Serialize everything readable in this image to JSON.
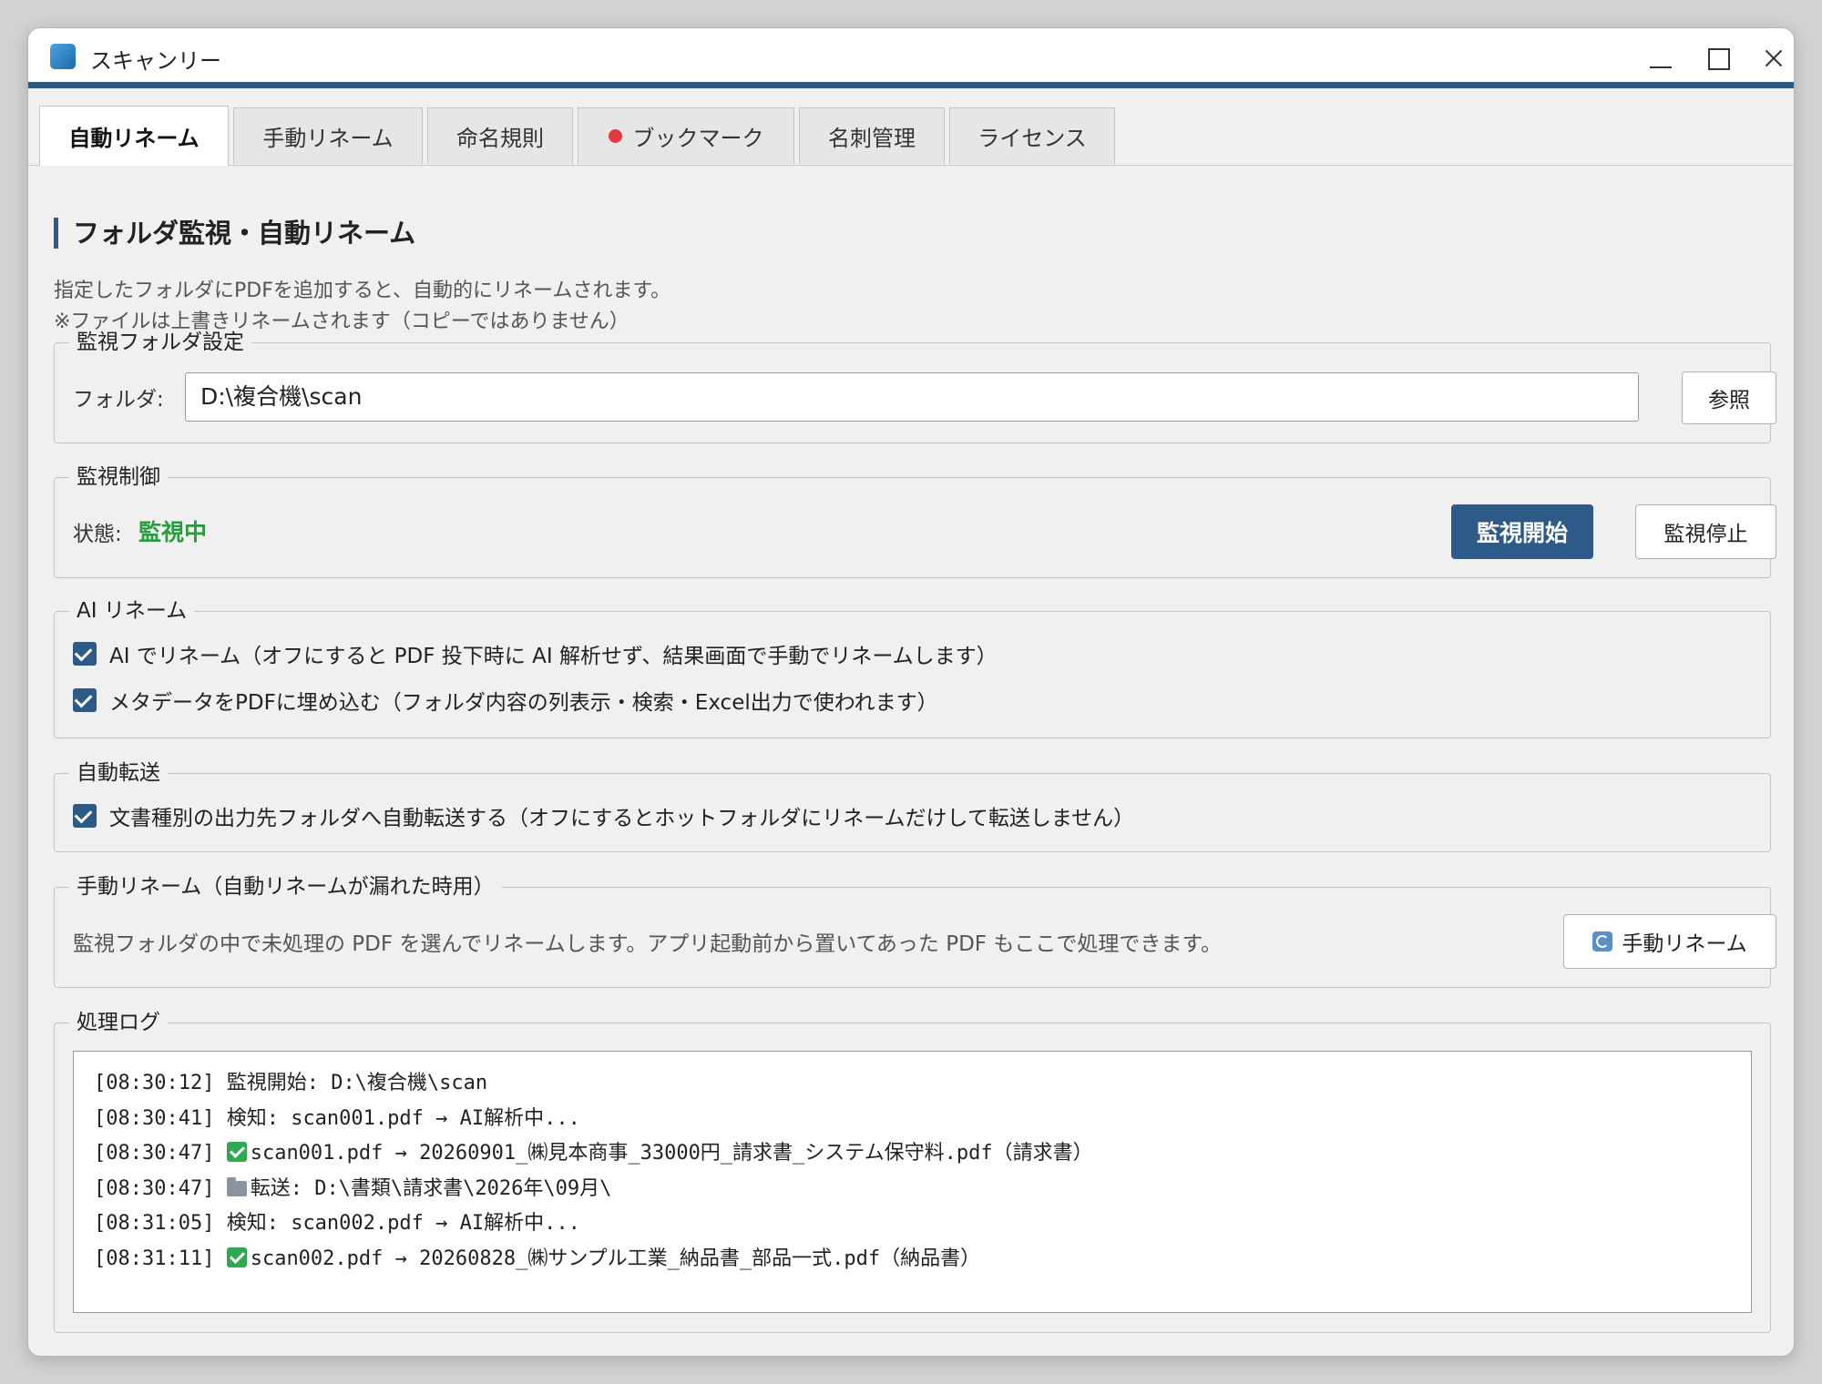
{
  "window": {
    "title": "スキャンリー"
  },
  "tabs": [
    {
      "label": "自動リネーム",
      "active": true
    },
    {
      "label": "手動リネーム"
    },
    {
      "label": "命名規則"
    },
    {
      "label": "ブックマーク",
      "indicator_color": "#e03b3b"
    },
    {
      "label": "名刺管理"
    },
    {
      "label": "ライセンス"
    }
  ],
  "section": {
    "title": "フォルダ監視・自動リネーム",
    "desc1": "指定したフォルダにPDFを追加すると、自動的にリネームされます。",
    "desc2": "※ファイルは上書きリネームされます（コピーではありません）"
  },
  "folder_settings": {
    "legend": "監視フォルダ設定",
    "folder_label": "フォルダ:",
    "folder_value": "D:\\複合機\\scan",
    "browse_label": "参照"
  },
  "monitor_control": {
    "legend": "監視制御",
    "status_label": "状態:",
    "status_value": "監視中",
    "start_label": "監視開始",
    "stop_label": "監視停止"
  },
  "ai_rename": {
    "legend": "AI リネーム",
    "options": [
      {
        "label": "AI でリネーム（オフにすると PDF 投下時に AI 解析せず、結果画面で手動でリネームします）",
        "checked": true
      },
      {
        "label": "メタデータをPDFに埋め込む（フォルダ内容の列表示・検索・Excel出力で使われます）",
        "checked": true
      }
    ]
  },
  "auto_transfer": {
    "legend": "自動転送",
    "option": {
      "label": "文書種別の出力先フォルダへ自動転送する（オフにするとホットフォルダにリネームだけして転送しません）",
      "checked": true
    }
  },
  "manual_rename": {
    "legend": "手動リネーム（自動リネームが漏れた時用）",
    "desc": "監視フォルダの中で未処理の PDF を選んでリネームします。アプリ起動前から置いてあった PDF もここで処理できます。",
    "button_label": "手動リネーム"
  },
  "log": {
    "legend": "処理ログ",
    "lines": [
      {
        "time": "[08:30:12]",
        "text": "監視開始: D:\\複合機\\scan"
      },
      {
        "time": "[08:30:41]",
        "text": "検知: scan001.pdf → AI解析中..."
      },
      {
        "time": "[08:30:47]",
        "icon": "check-icon",
        "text": "scan001.pdf → 20260901_㈱見本商事_33000円_請求書_システム保守料.pdf（請求書）"
      },
      {
        "time": "[08:30:47]",
        "icon": "folder-icon",
        "text": "転送: D:\\書類\\請求書\\2026年\\09月\\"
      },
      {
        "time": "[08:31:05]",
        "text": "検知: scan002.pdf → AI解析中..."
      },
      {
        "time": "[08:31:11]",
        "icon": "check-icon",
        "text": "scan002.pdf → 20260828_㈱サンプル工業_納品書_部品一式.pdf（納品書）"
      }
    ]
  }
}
